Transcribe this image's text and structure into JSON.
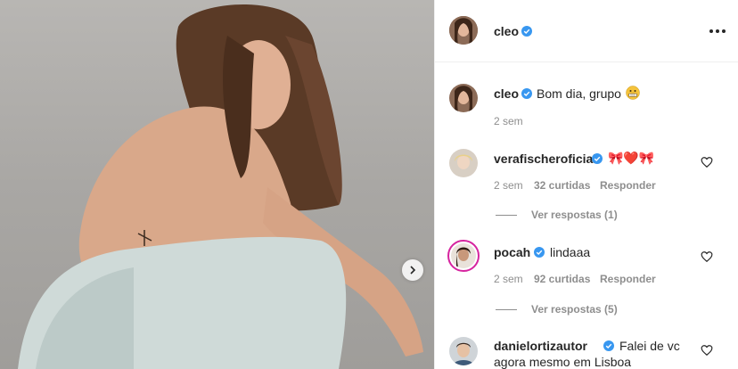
{
  "post": {
    "author": "cleo",
    "caption": "Bom dia, grupo",
    "caption_emoji": "grimacing-face",
    "caption_time": "2 sem"
  },
  "comments": [
    {
      "username": "verafischeroficial",
      "text": "🎀❤️🎀",
      "time": "2 sem",
      "likes": "32 curtidas",
      "reply": "Responder",
      "view_replies": "Ver respostas (1)"
    },
    {
      "username": "pocah",
      "text": "lindaaa",
      "time": "2 sem",
      "likes": "92 curtidas",
      "reply": "Responder",
      "view_replies": "Ver respostas (5)"
    },
    {
      "username": "danielortizautor",
      "text_line1": "Falei de vc",
      "text_line2": "agora mesmo em Lisboa"
    }
  ],
  "colors": {
    "verified": "#3897f0",
    "muted": "#8e8e8e",
    "story_ring": "#d6249f"
  },
  "icons": [
    "verified-badge-icon",
    "more-options-icon",
    "heart-outline-icon",
    "chevron-right-icon"
  ]
}
